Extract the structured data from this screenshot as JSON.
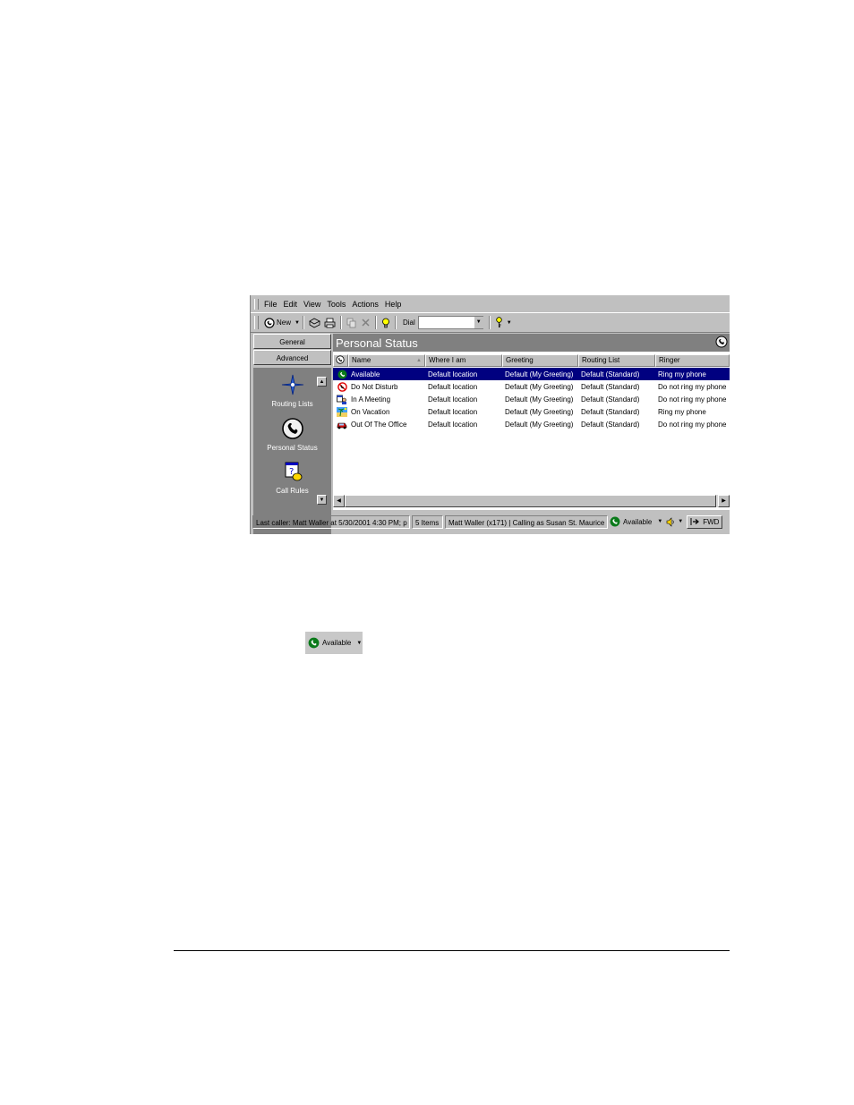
{
  "menu": [
    "File",
    "Edit",
    "View",
    "Tools",
    "Actions",
    "Help"
  ],
  "toolbar": {
    "new_label": "New",
    "dial_label": "Dial",
    "dial_value": ""
  },
  "sidebar": {
    "groups": [
      "General",
      "Advanced"
    ],
    "shortcuts": [
      "Routing Lists",
      "Personal Status",
      "Call Rules"
    ]
  },
  "main": {
    "title": "Personal Status",
    "columns": [
      "Name",
      "Where I am",
      "Greeting",
      "Routing List",
      "Ringer"
    ],
    "rows": [
      {
        "icon": "available-icon",
        "name": "Available",
        "where": "Default location",
        "greeting": "Default (My Greeting)",
        "routing": "Default (Standard)",
        "ringer": "Ring my phone"
      },
      {
        "icon": "do-not-disturb-icon",
        "name": "Do Not Disturb",
        "where": "Default location",
        "greeting": "Default (My Greeting)",
        "routing": "Default (Standard)",
        "ringer": "Do not ring my phone"
      },
      {
        "icon": "meeting-icon",
        "name": "In A Meeting",
        "where": "Default location",
        "greeting": "Default (My Greeting)",
        "routing": "Default (Standard)",
        "ringer": "Do not ring my phone"
      },
      {
        "icon": "vacation-icon",
        "name": "On Vacation",
        "where": "Default location",
        "greeting": "Default (My Greeting)",
        "routing": "Default (Standard)",
        "ringer": "Ring my phone"
      },
      {
        "icon": "out-of-office-icon",
        "name": "Out Of The Office",
        "where": "Default location",
        "greeting": "Default (My Greeting)",
        "routing": "Default (Standard)",
        "ringer": "Do not ring my phone"
      }
    ],
    "selected_row": 0
  },
  "statusbar": {
    "last_caller": "Last caller: Matt Waller at 5/30/2001 4:30 PM; p",
    "items": "5 Items",
    "user": "Matt Waller (x171) | Calling as Susan St. Maurice",
    "status": "Available",
    "fwd": "FWD"
  },
  "standalone": {
    "label": "Available"
  },
  "colors": {
    "selection": "#000080",
    "header": "#808080",
    "face": "#c0c0c0",
    "available_green": "#0a7a1a"
  }
}
